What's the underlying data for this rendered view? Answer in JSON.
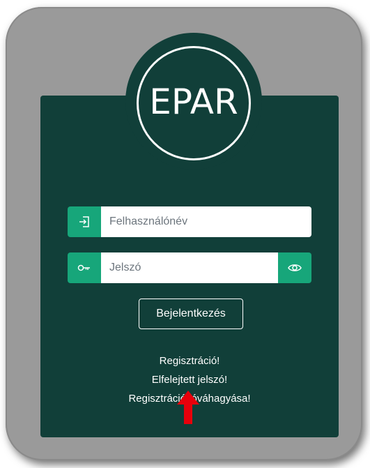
{
  "logo": {
    "text": "EPAR"
  },
  "form": {
    "username_placeholder": "Felhasználónév",
    "password_placeholder": "Jelszó",
    "login_label": "Bejelentkezés"
  },
  "links": {
    "register": "Regisztráció!",
    "forgot_password": "Elfelejtett jelszó!",
    "confirm_registration": "Regisztráció jóváhagyása!"
  },
  "colors": {
    "card_background": "#113f39",
    "accent_green": "#17a67a",
    "frame_gray": "#9a9a9a",
    "arrow_red": "#e8000b"
  },
  "icons": {
    "username": "sign-in-icon",
    "password": "key-icon",
    "toggle_visibility": "eye-icon",
    "annotation": "red-up-arrow"
  }
}
